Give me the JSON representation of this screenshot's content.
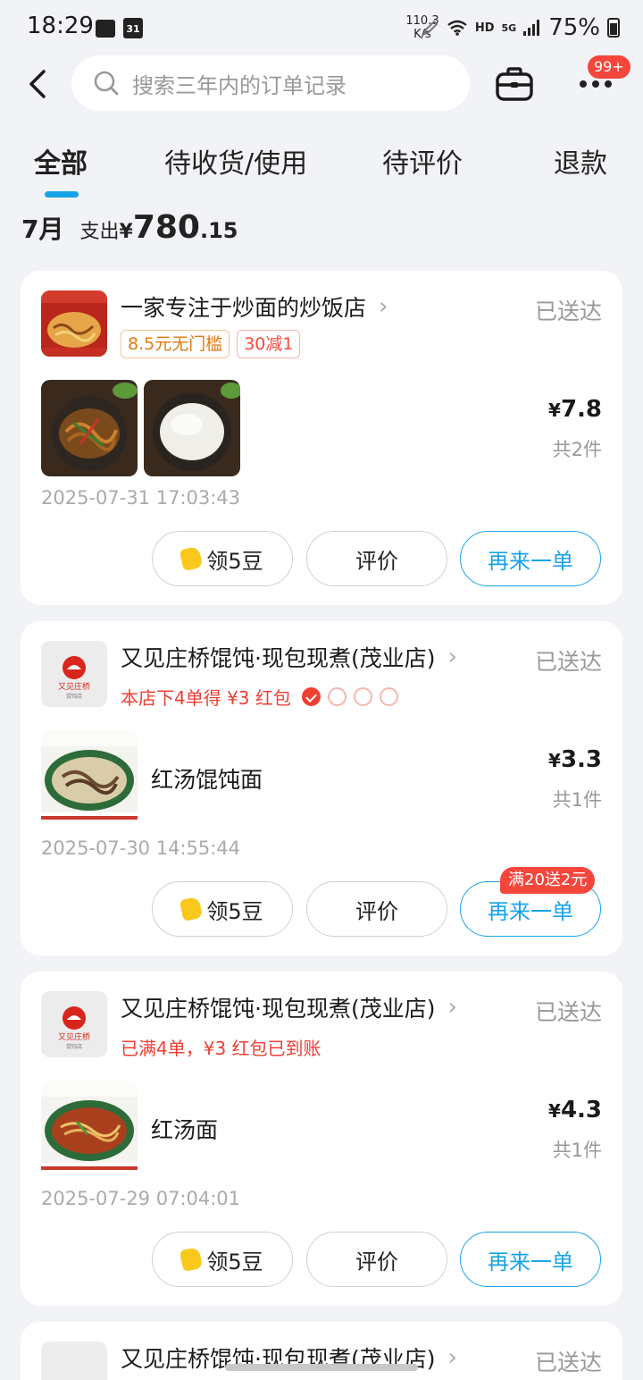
{
  "status_bar": {
    "time": "18:29",
    "calendar_day": "31",
    "speed_value": "110.3",
    "speed_unit": "K/s",
    "hd": "HD",
    "network": "5G",
    "battery": "75%"
  },
  "header": {
    "search_placeholder": "搜索三年内的订单记录",
    "more_badge": "99+"
  },
  "tabs": [
    "全部",
    "待收货/使用",
    "待评价",
    "退款"
  ],
  "summary": {
    "month": "7月",
    "label": "支出",
    "currency": "¥",
    "amount_int": "780",
    "amount_dec": ".15"
  },
  "orders": [
    {
      "store": "一家专注于炒面的炒饭店",
      "status": "已送达",
      "tags": [
        "8.5元无门槛",
        "30减1"
      ],
      "currency": "¥",
      "price": "7.8",
      "count": "共2件",
      "time": "2025-07-31 17:03:43",
      "buttons": [
        "领5豆",
        "评价",
        "再来一单"
      ]
    },
    {
      "store": "又见庄桥馄饨·现包现煮(茂业店)",
      "status": "已送达",
      "promo": "本店下4单得 ¥3 红包",
      "item": "红汤馄饨面",
      "currency": "¥",
      "price": "3.3",
      "count": "共1件",
      "time": "2025-07-30 14:55:44",
      "buttons": [
        "领5豆",
        "评价",
        "再来一单"
      ],
      "reorder_badge": "满20送2元"
    },
    {
      "store": "又见庄桥馄饨·现包现煮(茂业店)",
      "status": "已送达",
      "promo": "已满4单，¥3 红包已到账",
      "item": "红汤面",
      "currency": "¥",
      "price": "4.3",
      "count": "共1件",
      "time": "2025-07-29 07:04:01",
      "buttons": [
        "领5豆",
        "评价",
        "再来一单"
      ]
    },
    {
      "store": "又见庄桥馄饨·现包现煮(茂业店)",
      "status": "已送达"
    }
  ],
  "logo_text": {
    "line1": "又见庄桥",
    "line2": "馄饨店"
  },
  "colors": {
    "accent": "#18a3e8",
    "red": "#ef3f33",
    "orange": "#e07a12",
    "background": "#f2f3f6"
  }
}
